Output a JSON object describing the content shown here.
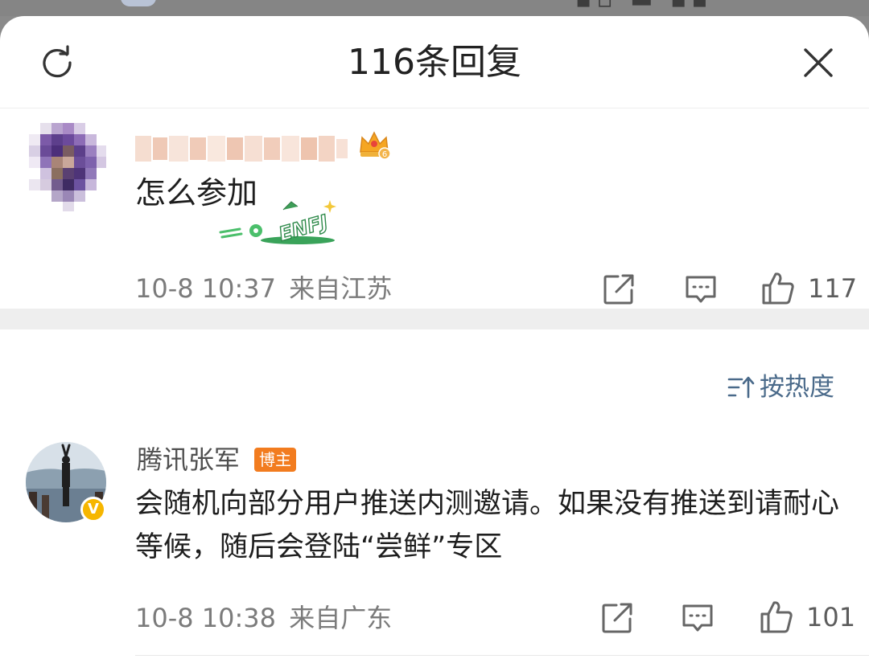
{
  "header": {
    "title": "116条回复"
  },
  "main_comment": {
    "text": "怎么参加",
    "time": "10-8 10:37",
    "location": "来自江苏",
    "likes": "117",
    "sticker_text": "ENFJ",
    "crown_level": "6"
  },
  "sort": {
    "label": "按热度"
  },
  "reply": {
    "author": "腾讯张军",
    "badge": "博主",
    "verified_mark": "V",
    "text": "会随机向部分用户推送内测邀请。如果没有推送到请耐心等候，随后会登陆“尝鲜”专区",
    "time": "10-8 10:38",
    "location": "来自广东",
    "likes": "101"
  },
  "colors": {
    "accent_link": "#4a6a8a",
    "badge_orange": "#f27c1f",
    "verified_gold": "#f6b600",
    "meta_gray": "#7b7b7b"
  }
}
